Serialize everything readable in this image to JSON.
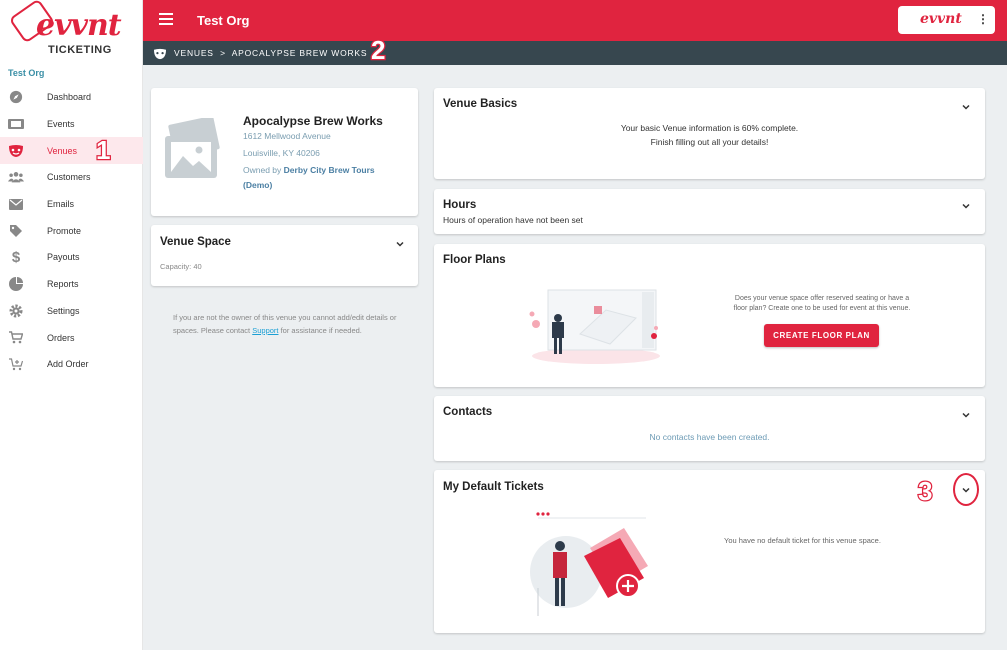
{
  "sidebar": {
    "logo_text": "evvnt",
    "logo_sub": "TICKETING",
    "org": "Test Org",
    "items": [
      {
        "label": "Dashboard",
        "icon": "compass-icon"
      },
      {
        "label": "Events",
        "icon": "ticket-icon"
      },
      {
        "label": "Venues",
        "icon": "theater-masks-icon",
        "active": true
      },
      {
        "label": "Customers",
        "icon": "users-icon"
      },
      {
        "label": "Emails",
        "icon": "envelope-icon"
      },
      {
        "label": "Promote",
        "icon": "tag-icon"
      },
      {
        "label": "Payouts",
        "icon": "dollar-icon"
      },
      {
        "label": "Reports",
        "icon": "pie-chart-icon"
      },
      {
        "label": "Settings",
        "icon": "gear-icon"
      },
      {
        "label": "Orders",
        "icon": "cart-icon"
      },
      {
        "label": "Add Order",
        "icon": "cart-plus-icon"
      }
    ],
    "step_marker": "1"
  },
  "topbar": {
    "title": "Test Org",
    "logo_text": "evvnt"
  },
  "breadcrumb": {
    "text": "VENUES  >  APOCALYPSE BREW WORKS",
    "step_marker": "2"
  },
  "venue": {
    "name": "Apocalypse Brew Works",
    "address1": "1612 Mellwood Avenue",
    "address2": "Louisville, KY 40206",
    "owned_by_prefix": "Owned by ",
    "owner_line1": "Derby City Brew Tours",
    "owner_line2": "(Demo)"
  },
  "venue_space": {
    "title": "Venue Space",
    "capacity": "Capacity: 40"
  },
  "owner_note": {
    "before": "If you are not the owner of this venue you cannot add/edit details or spaces. Please contact ",
    "link": "Support",
    "after": " for assistance if needed."
  },
  "basics": {
    "title": "Venue Basics",
    "line1": "Your basic Venue information is 60% complete.",
    "line2": "Finish filling out all your details!"
  },
  "hours": {
    "title": "Hours",
    "subtitle": "Hours of operation have not been set"
  },
  "floor_plans": {
    "title": "Floor Plans",
    "line1": "Does your venue space offer reserved seating or have a",
    "line2": "floor plan? Create one to be used for event at this venue.",
    "button": "CREATE FLOOR PLAN"
  },
  "contacts": {
    "title": "Contacts",
    "empty": "No contacts have been created."
  },
  "tickets": {
    "title": "My Default Tickets",
    "empty": "You have no default ticket for this venue space.",
    "step_marker": "3"
  },
  "colors": {
    "brand": "#e0243f",
    "crumbbar": "#37474f",
    "background": "#eceff1"
  }
}
